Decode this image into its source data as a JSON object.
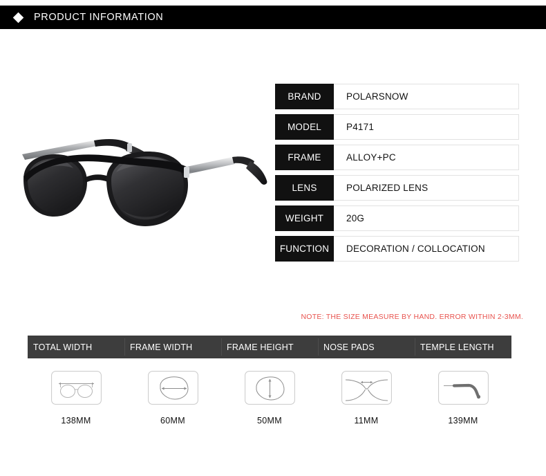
{
  "header": {
    "bullet_icon": "diamond-icon",
    "title": "PRODUCT INFORMATION",
    "background": "#000000",
    "text_color": "#ffffff"
  },
  "product_photo": {
    "alt": "black round polarized sunglasses with silver metal temples"
  },
  "spec_table": {
    "label_background": "#111111",
    "rows": [
      {
        "label": "BRAND",
        "value": "POLARSNOW"
      },
      {
        "label": "MODEL",
        "value": "P4171"
      },
      {
        "label": "FRAME",
        "value": "ALLOY+PC"
      },
      {
        "label": "LENS",
        "value": "POLARIZED LENS"
      },
      {
        "label": "WEIGHT",
        "value": "20G"
      },
      {
        "label": "FUNCTION",
        "value": "DECORATION / COLLOCATION"
      }
    ]
  },
  "note": {
    "text": "NOTE: THE SIZE MEASURE BY HAND. ERROR WITHIN 2-3MM.",
    "color": "#e8534e"
  },
  "measurements": {
    "header_background": "#3d3d3d",
    "columns": [
      {
        "header": "TOTAL WIDTH",
        "value": "138MM",
        "diagram": "full-frame-width-icon"
      },
      {
        "header": "FRAME WIDTH",
        "value": "60MM",
        "diagram": "lens-width-icon"
      },
      {
        "header": "FRAME HEIGHT",
        "value": "50MM",
        "diagram": "lens-height-icon"
      },
      {
        "header": "NOSE PADS",
        "value": "11MM",
        "diagram": "nose-bridge-icon"
      },
      {
        "header": "TEMPLE LENGTH",
        "value": "139MM",
        "diagram": "temple-arm-icon"
      }
    ]
  }
}
